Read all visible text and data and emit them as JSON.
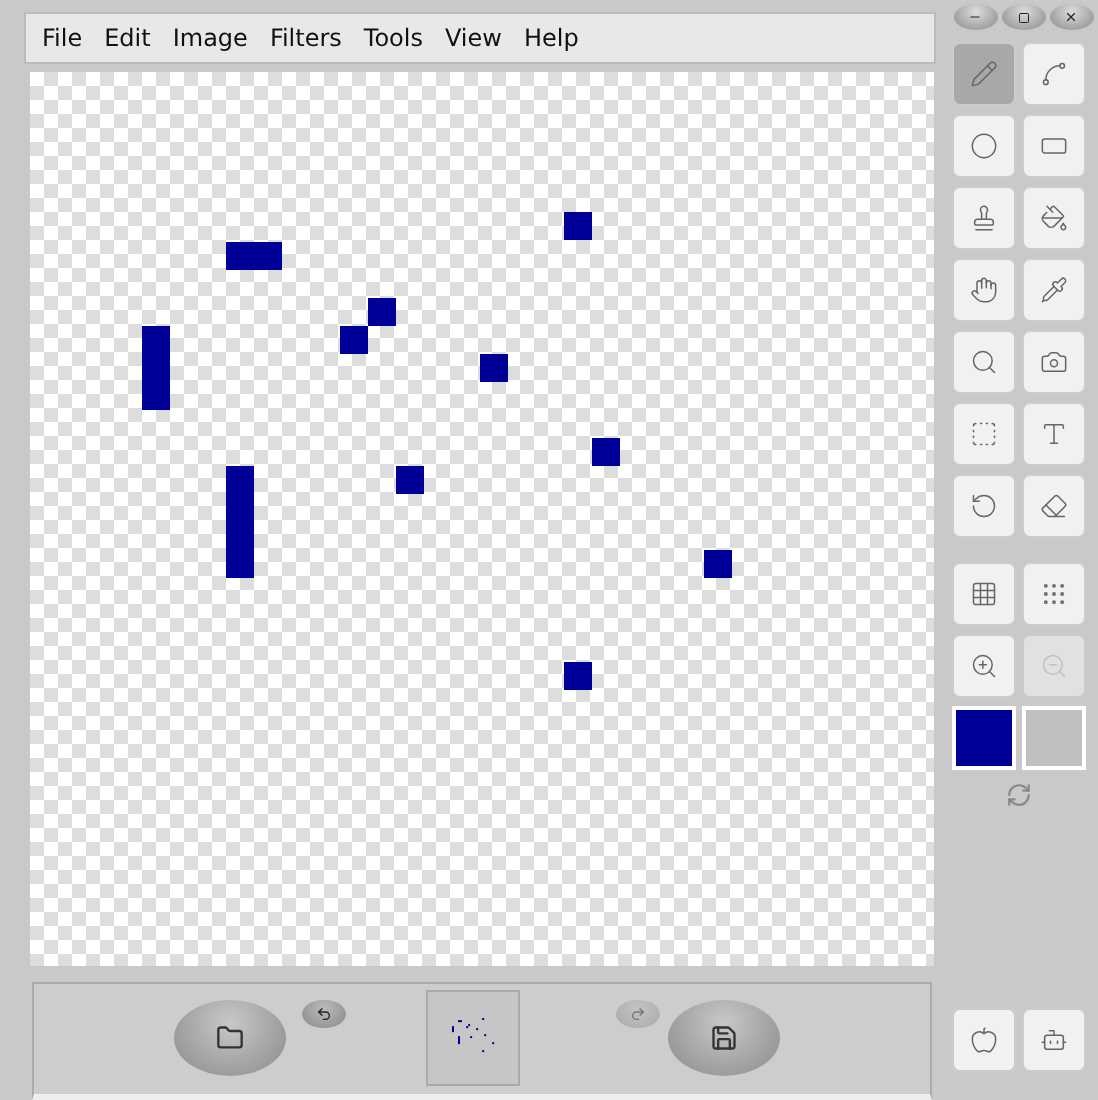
{
  "menu": [
    {
      "label": "File"
    },
    {
      "label": "Edit"
    },
    {
      "label": "Image"
    },
    {
      "label": "Filters"
    },
    {
      "label": "Tools"
    },
    {
      "label": "View"
    },
    {
      "label": "Help"
    }
  ],
  "tools": [
    {
      "selected": true
    },
    {
      "selected": false
    },
    {
      "selected": false
    },
    {
      "selected": false
    },
    {
      "selected": false
    },
    {
      "selected": false
    },
    {
      "selected": false
    },
    {
      "selected": false
    },
    {
      "selected": false
    },
    {
      "selected": false
    },
    {
      "selected": false
    },
    {
      "selected": false
    },
    {
      "selected": false
    },
    {
      "selected": false
    }
  ],
  "view_tools": [
    {
      "disabled": false
    },
    {
      "disabled": false
    },
    {
      "disabled": false
    },
    {
      "disabled": true
    }
  ],
  "colors": [
    {
      "color": "#000099"
    },
    {
      "color": "#c0c0c0"
    }
  ],
  "history": [
    {
      "disabled": false
    },
    {
      "disabled": true
    }
  ]
}
